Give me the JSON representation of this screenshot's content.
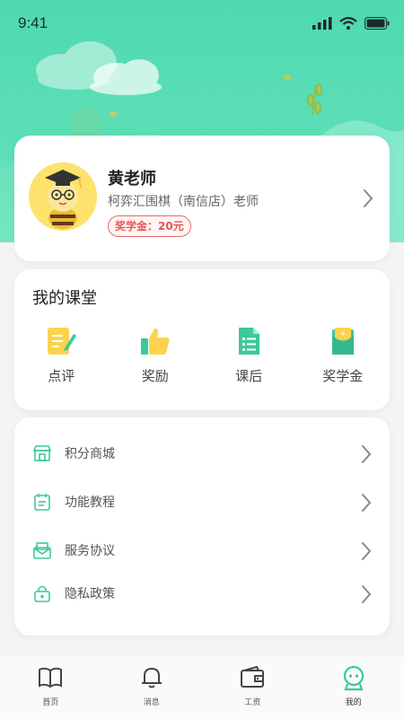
{
  "status": {
    "time": "9:41"
  },
  "profile": {
    "name": "黄老师",
    "organization": "柯弈汇围棋（南信店）老师",
    "reward": "奖学金：20元"
  },
  "classroom": {
    "title": "我的课堂",
    "items": [
      {
        "label": "点评",
        "icon": "review-icon"
      },
      {
        "label": "奖励",
        "icon": "thumbs-up-icon"
      },
      {
        "label": "课后",
        "icon": "homework-icon"
      },
      {
        "label": "奖学金",
        "icon": "scholarship-icon"
      }
    ]
  },
  "menu": {
    "items": [
      {
        "label": "积分商城",
        "icon": "store-icon"
      },
      {
        "label": "功能教程",
        "icon": "tutorial-icon"
      },
      {
        "label": "服务协议",
        "icon": "agreement-icon"
      },
      {
        "label": "隐私政策",
        "icon": "lock-icon"
      }
    ]
  },
  "tabbar": {
    "items": [
      {
        "label": "首页",
        "icon": "book-icon"
      },
      {
        "label": "消息",
        "icon": "bell-icon"
      },
      {
        "label": "工资",
        "icon": "wallet-icon"
      },
      {
        "label": "我的",
        "icon": "profile-icon",
        "active": true
      }
    ]
  },
  "colors": {
    "accent": "#4fd9ae",
    "reward": "#e45757"
  }
}
